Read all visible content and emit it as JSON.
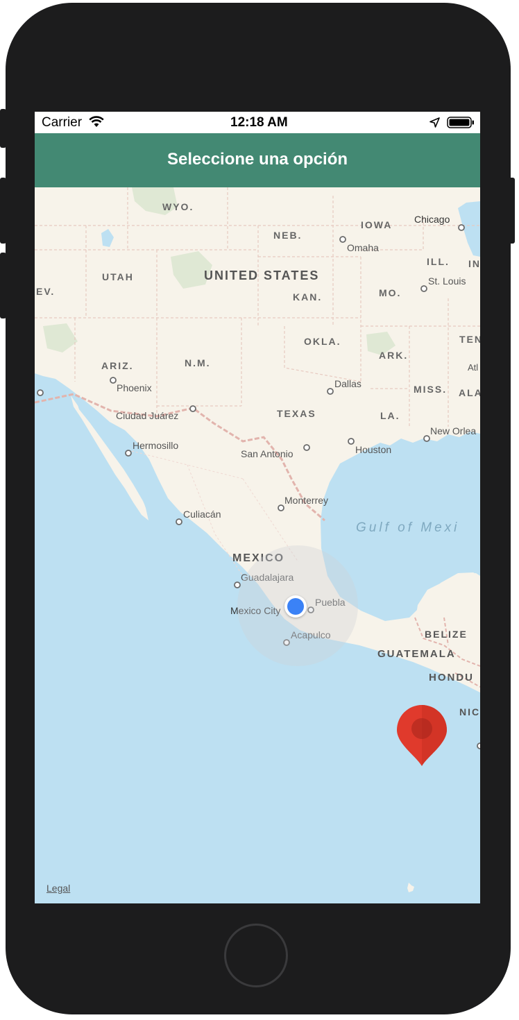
{
  "status_bar": {
    "carrier": "Carrier",
    "time": "12:18 AM"
  },
  "header": {
    "title": "Seleccione una opción"
  },
  "map": {
    "states": [
      "WYO.",
      "NEB.",
      "IOWA",
      "ILL.",
      "IN",
      "UTAH",
      "UNITED STATES",
      "KAN.",
      "MO.",
      "EV.",
      "OKLA.",
      "TEN",
      "ARIZ.",
      "N.M.",
      "ARK.",
      "MISS.",
      "ALA",
      "TEXAS",
      "LA."
    ],
    "cities": [
      "Chicago",
      "Omaha",
      "St. Louis",
      "Phoenix",
      "Dallas",
      "Ciudad Juárez",
      "Hermosillo",
      "San Antonio",
      "Houston",
      "New Orlea",
      "Monterrey",
      "Culiacán",
      "Guadalajara",
      "Mexico City",
      "Puebla",
      "Acapulco",
      "Atl"
    ],
    "countries": [
      "MEXICO",
      "BELIZE",
      "GUATEMALA",
      "HONDU",
      "NIC"
    ],
    "water": "Gulf of Mexi",
    "legal": "Legal"
  },
  "colors": {
    "nav": "#438973",
    "land": "#f7f3ea",
    "water": "#bde0f2",
    "pin": "#e03a2c",
    "user_dot": "#3b82f6"
  }
}
